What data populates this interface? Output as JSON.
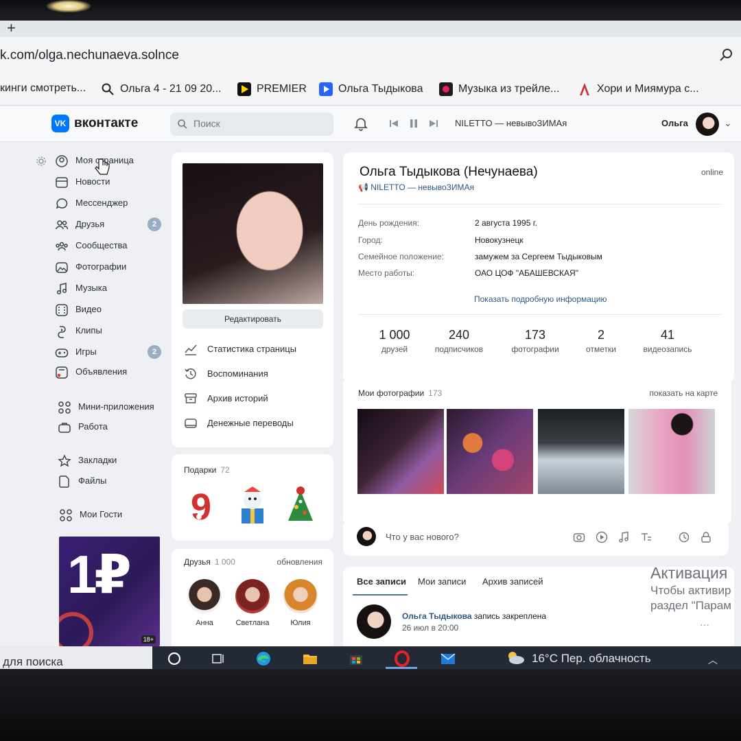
{
  "browser": {
    "url": "k.com/olga.nechunaeva.solnce",
    "newtab": "+",
    "bookmarks": [
      {
        "label": "кинги смотреть...",
        "icon": "none"
      },
      {
        "label": "Ольга 4 - 21 09 20...",
        "icon": "search-icon"
      },
      {
        "label": "PREMIER",
        "icon": "play-icon",
        "color": "#111111"
      },
      {
        "label": "Ольга Тыдыкова",
        "icon": "play-icon",
        "color": "#2962ff"
      },
      {
        "label": "Музыка из трейле...",
        "icon": "record-icon",
        "color": "#e91e63"
      },
      {
        "label": "Хори и Миямура с...",
        "icon": "letter-a-icon",
        "color": "#d32f2f"
      }
    ]
  },
  "header": {
    "logo": "VK",
    "brand": "вконтакте",
    "search_placeholder": "Поиск",
    "track": "NILETTO — невывоЗИМАя",
    "user": "Ольга",
    "accent": "#0077ff"
  },
  "menu": {
    "items": [
      {
        "label": "Моя страница",
        "icon": "user-icon"
      },
      {
        "label": "Новости",
        "icon": "news-icon"
      },
      {
        "label": "Мессенджер",
        "icon": "chat-icon"
      },
      {
        "label": "Друзья",
        "icon": "friends-icon",
        "badge": "2"
      },
      {
        "label": "Сообщества",
        "icon": "communities-icon"
      },
      {
        "label": "Фотографии",
        "icon": "photo-icon"
      },
      {
        "label": "Музыка",
        "icon": "music-icon"
      },
      {
        "label": "Видео",
        "icon": "video-icon"
      },
      {
        "label": "Клипы",
        "icon": "clips-icon"
      },
      {
        "label": "Игры",
        "icon": "games-icon",
        "badge": "2"
      },
      {
        "label": "Объявления",
        "icon": "ads-icon"
      },
      {
        "label": "Мини-приложения",
        "icon": "apps-icon"
      },
      {
        "label": "Работа",
        "icon": "briefcase-icon"
      },
      {
        "label": "Закладки",
        "icon": "star-icon"
      },
      {
        "label": "Файлы",
        "icon": "file-icon"
      },
      {
        "label": "Мои Гости",
        "icon": "apps-icon"
      }
    ]
  },
  "ad": {
    "text": "1₽",
    "age": "18+"
  },
  "profile": {
    "edit_label": "Редактировать",
    "actions": [
      {
        "label": "Статистика страницы",
        "icon": "stats-icon"
      },
      {
        "label": "Воспоминания",
        "icon": "history-icon"
      },
      {
        "label": "Архив историй",
        "icon": "archive-icon"
      },
      {
        "label": "Денежные переводы",
        "icon": "money-icon"
      }
    ],
    "name": "Ольга Тыдыкова (Нечунаева)",
    "online": "online",
    "status": "NILETTO — невывоЗИМАя",
    "info": [
      {
        "label": "День рождения:",
        "value": "2 августа 1995 г."
      },
      {
        "label": "Город:",
        "value": "Новокузнецк"
      },
      {
        "label": "Семейное положение:",
        "value": "замужем за Сергеем Тыдыковым"
      },
      {
        "label": "Место работы:",
        "value": "ОАО ЦОФ \"АБАШЕВСКАЯ\""
      }
    ],
    "more_info": "Показать подробную информацию",
    "counters": [
      {
        "num": "1 000",
        "label": "друзей"
      },
      {
        "num": "240",
        "label": "подписчиков"
      },
      {
        "num": "173",
        "label": "фотографии"
      },
      {
        "num": "2",
        "label": "отметки"
      },
      {
        "num": "41",
        "label": "видеозапись"
      }
    ]
  },
  "gifts": {
    "title": "Подарки",
    "count": "72"
  },
  "friends": {
    "title": "Друзья",
    "count": "1 000",
    "updates": "обновления",
    "list": [
      {
        "name": "Анна"
      },
      {
        "name": "Светлана"
      },
      {
        "name": "Юлия"
      }
    ]
  },
  "photos": {
    "title": "Мои фотографии",
    "count": "173",
    "map_link": "показать на карте"
  },
  "newpost": {
    "placeholder": "Что у вас нового?"
  },
  "wall": {
    "tabs": [
      "Все записи",
      "Мои записи",
      "Архив записей"
    ],
    "post_author": "Ольга Тыдыкова",
    "post_note": "запись закреплена",
    "post_date": "26 июл в 20:00"
  },
  "activation": {
    "title": "Активация",
    "line1": "Чтобы активир",
    "line2": "раздел \"Парам"
  },
  "taskbar": {
    "search_text": "для поиска",
    "weather": "16°C  Пер. облачность"
  }
}
